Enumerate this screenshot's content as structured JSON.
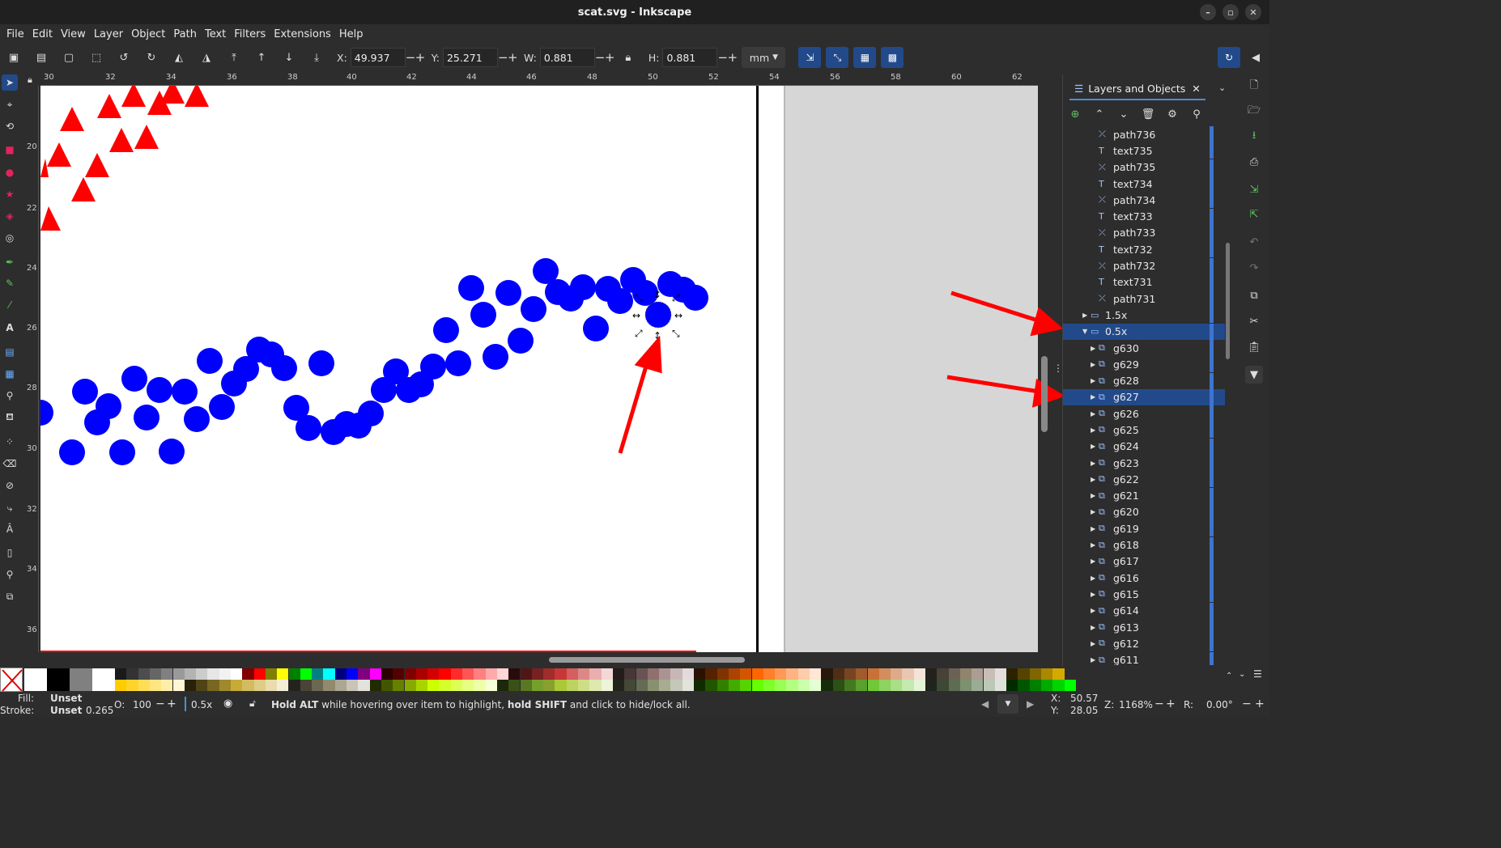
{
  "window": {
    "title": "scat.svg - Inkscape"
  },
  "menu": [
    "File",
    "Edit",
    "View",
    "Layer",
    "Object",
    "Path",
    "Text",
    "Filters",
    "Extensions",
    "Help"
  ],
  "toolbar": {
    "x_label": "X:",
    "x_value": "49.937",
    "y_label": "Y:",
    "y_value": "25.271",
    "w_label": "W:",
    "w_value": "0.881",
    "h_label": "H:",
    "h_value": "0.881",
    "unit": "mm"
  },
  "ruler": {
    "top": [
      "30",
      "32",
      "34",
      "36",
      "38",
      "40",
      "42",
      "44",
      "46",
      "48",
      "50",
      "52",
      "54",
      "56",
      "58",
      "60",
      "62"
    ],
    "left": [
      "20",
      "22",
      "24",
      "26",
      "28",
      "30",
      "32",
      "34",
      "36"
    ]
  },
  "panel": {
    "tab_label": "Layers and Objects",
    "rows": [
      {
        "label": "path736",
        "type": "path",
        "level": 2,
        "arrow": ""
      },
      {
        "label": "text735",
        "type": "text",
        "level": 2,
        "arrow": ""
      },
      {
        "label": "path735",
        "type": "path",
        "level": 2,
        "arrow": ""
      },
      {
        "label": "text734",
        "type": "text",
        "level": 2,
        "arrow": ""
      },
      {
        "label": "path734",
        "type": "path",
        "level": 2,
        "arrow": ""
      },
      {
        "label": "text733",
        "type": "text",
        "level": 2,
        "arrow": ""
      },
      {
        "label": "path733",
        "type": "path",
        "level": 2,
        "arrow": ""
      },
      {
        "label": "text732",
        "type": "text",
        "level": 2,
        "arrow": ""
      },
      {
        "label": "path732",
        "type": "path",
        "level": 2,
        "arrow": ""
      },
      {
        "label": "text731",
        "type": "text",
        "level": 2,
        "arrow": ""
      },
      {
        "label": "path731",
        "type": "path",
        "level": 2,
        "arrow": ""
      },
      {
        "label": "1.5x",
        "type": "layer",
        "level": 1,
        "arrow": "▶"
      },
      {
        "label": "0.5x",
        "type": "layer",
        "level": 1,
        "arrow": "▼",
        "selected": true
      },
      {
        "label": "g630",
        "type": "group",
        "level": 2,
        "arrow": "▶"
      },
      {
        "label": "g629",
        "type": "group",
        "level": 2,
        "arrow": "▶"
      },
      {
        "label": "g628",
        "type": "group",
        "level": 2,
        "arrow": "▶"
      },
      {
        "label": "g627",
        "type": "group",
        "level": 2,
        "arrow": "▶",
        "selected": true
      },
      {
        "label": "g626",
        "type": "group",
        "level": 2,
        "arrow": "▶"
      },
      {
        "label": "g625",
        "type": "group",
        "level": 2,
        "arrow": "▶"
      },
      {
        "label": "g624",
        "type": "group",
        "level": 2,
        "arrow": "▶"
      },
      {
        "label": "g623",
        "type": "group",
        "level": 2,
        "arrow": "▶"
      },
      {
        "label": "g622",
        "type": "group",
        "level": 2,
        "arrow": "▶"
      },
      {
        "label": "g621",
        "type": "group",
        "level": 2,
        "arrow": "▶"
      },
      {
        "label": "g620",
        "type": "group",
        "level": 2,
        "arrow": "▶"
      },
      {
        "label": "g619",
        "type": "group",
        "level": 2,
        "arrow": "▶"
      },
      {
        "label": "g618",
        "type": "group",
        "level": 2,
        "arrow": "▶"
      },
      {
        "label": "g617",
        "type": "group",
        "level": 2,
        "arrow": "▶"
      },
      {
        "label": "g616",
        "type": "group",
        "level": 2,
        "arrow": "▶"
      },
      {
        "label": "g615",
        "type": "group",
        "level": 2,
        "arrow": "▶"
      },
      {
        "label": "g614",
        "type": "group",
        "level": 2,
        "arrow": "▶"
      },
      {
        "label": "g613",
        "type": "group",
        "level": 2,
        "arrow": "▶"
      },
      {
        "label": "g612",
        "type": "group",
        "level": 2,
        "arrow": "▶"
      },
      {
        "label": "g611",
        "type": "group",
        "level": 2,
        "arrow": "▶"
      }
    ]
  },
  "status": {
    "fill_label": "Fill:",
    "fill_value": "Unset",
    "stroke_label": "Stroke:",
    "stroke_value": "Unset",
    "stroke_width": "0.265",
    "opacity_label": "O:",
    "opacity_value": "100",
    "layer": "0.5x",
    "hint_bold1": "Hold ALT",
    "hint_mid": " while hovering over item to highlight, ",
    "hint_bold2": "hold SHIFT",
    "hint_end": " and click to hide/lock all.",
    "x_label": "X:",
    "x_value": "50.57",
    "y_label": "Y:",
    "y_value": "28.05",
    "zoom_label": "Z:",
    "zoom_value": "1168%",
    "rot_label": "R:",
    "rot_value": "0.00°"
  },
  "colors": {
    "accent": "#224a8a",
    "circle_fill": "#0000ff",
    "triangle_fill": "#ff0000",
    "annotation_arrow": "#ff0000"
  },
  "palette_top": [
    "#ffffff",
    "#000000",
    "#808080",
    "#ffffff",
    "#1a1a1a",
    "#333333",
    "#4d4d4d",
    "#666666",
    "#808080",
    "#999999",
    "#b3b3b3",
    "#cccccc",
    "#e6e6e6",
    "#f2f2f2",
    "#ffffff",
    "#800000",
    "#ff0000",
    "#808000",
    "#ffff00",
    "#008000",
    "#00ff00",
    "#008080",
    "#00ffff",
    "#000080",
    "#0000ff",
    "#800080",
    "#ff00ff",
    "#2b0000",
    "#550000",
    "#800000",
    "#aa0000",
    "#d40000",
    "#ff0000",
    "#ff2a2a",
    "#ff5555",
    "#ff8080",
    "#ffaaaa",
    "#ffd5d5",
    "#280b0b",
    "#501616",
    "#782121",
    "#a02c2c",
    "#c83737",
    "#d35f5f",
    "#de8787",
    "#e9afaf",
    "#f4d7d7",
    "#241c1c",
    "#483737",
    "#6c5353",
    "#916f6f",
    "#ac9393",
    "#c8b7b7",
    "#e3dbdb",
    "#2b1100",
    "#552200",
    "#803300",
    "#aa4400",
    "#d45500",
    "#ff6600",
    "#ff7f2a",
    "#ff9955",
    "#ffb380",
    "#ffccaa",
    "#ffe6d5",
    "#28170b",
    "#502d16",
    "#784421",
    "#a05a2c",
    "#c87137",
    "#d38d5f",
    "#deaa87",
    "#e9c6af",
    "#f4e3d7",
    "#24211c",
    "#484137",
    "#6c6253",
    "#91846f",
    "#ac9d93",
    "#c8beb7",
    "#e3dedb",
    "#2b2200",
    "#554400",
    "#806600",
    "#aa8800",
    "#d4aa00"
  ],
  "palette_bottom": [
    "#ffcc00",
    "#ffd42a",
    "#ffdd55",
    "#ffe680",
    "#ffeeaa",
    "#fff6d5",
    "#28220b",
    "#504416",
    "#786721",
    "#a0892c",
    "#c8ab37",
    "#d3bc5f",
    "#decd87",
    "#e9ddaf",
    "#f4eed7",
    "#24221c",
    "#484537",
    "#6c6753",
    "#918a6f",
    "#aca793",
    "#c8c4b7",
    "#e3e2db",
    "#222b00",
    "#445500",
    "#668000",
    "#88aa00",
    "#aad400",
    "#ccff00",
    "#d4ff2a",
    "#ddff55",
    "#e5ff80",
    "#eeffaa",
    "#f6ffd5",
    "#1d280b",
    "#3b5016",
    "#587821",
    "#76a02c",
    "#89a02c",
    "#abc837",
    "#bcd35f",
    "#cdde87",
    "#dde9af",
    "#eef4d7",
    "#22241c",
    "#444837",
    "#666c53",
    "#88916f",
    "#a7ac93",
    "#c4c8b7",
    "#e2e3db",
    "#112b00",
    "#225500",
    "#338000",
    "#44aa00",
    "#55d400",
    "#66ff00",
    "#7fff2a",
    "#99ff55",
    "#b3ff80",
    "#ccffaa",
    "#e5ffd5",
    "#162b0b",
    "#2d5016",
    "#447821",
    "#5aa02c",
    "#71c837",
    "#8dd35f",
    "#aade87",
    "#c6e9af",
    "#e3f4d7",
    "#1f241c",
    "#3e4837",
    "#5d6c53",
    "#7c916f",
    "#9aac93",
    "#bcc8b7",
    "#dde3db",
    "#002b00",
    "#005500",
    "#008000",
    "#00aa00",
    "#00d400",
    "#00ff00"
  ]
}
